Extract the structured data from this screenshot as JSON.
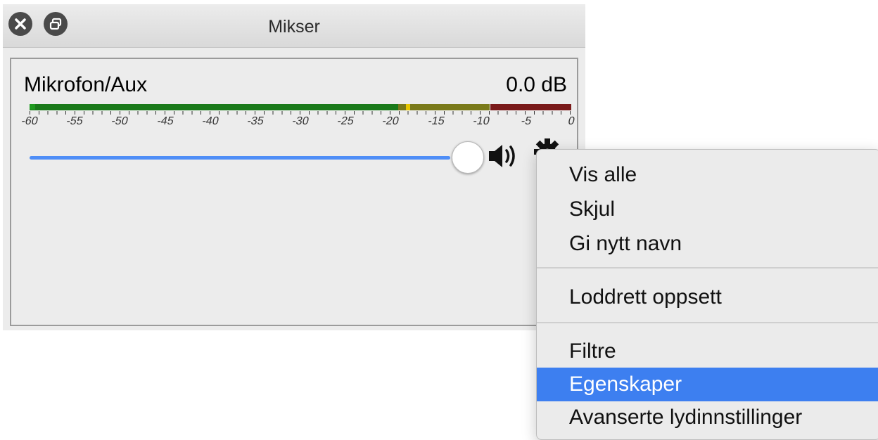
{
  "window": {
    "title": "Mikser",
    "close_icon": "close-icon",
    "float_icon": "undock-icon"
  },
  "mixer": {
    "source_name": "Mikrofon/Aux",
    "volume_db": "0.0 dB",
    "meter_ticks": [
      "-60",
      "-55",
      "-50",
      "-45",
      "-40",
      "-35",
      "-30",
      "-25",
      "-20",
      "-15",
      "-10",
      "-5",
      "0"
    ],
    "volume_level": 1.0,
    "colors": {
      "slider": "#4f8ef7",
      "green": "#1a7a1a",
      "yellow": "#7a7a1a",
      "red": "#7a1a1a",
      "peak_marker": "#e6c600"
    }
  },
  "context_menu": {
    "items": [
      {
        "label": "Vis alle"
      },
      {
        "label": "Skjul"
      },
      {
        "label": "Gi nytt navn"
      },
      {
        "label": "Loddrett oppsett"
      },
      {
        "label": "Filtre"
      },
      {
        "label": "Egenskaper",
        "highlighted": true
      },
      {
        "label": "Avanserte lydinnstillinger"
      }
    ],
    "highlight_color": "#3d7ff0"
  }
}
